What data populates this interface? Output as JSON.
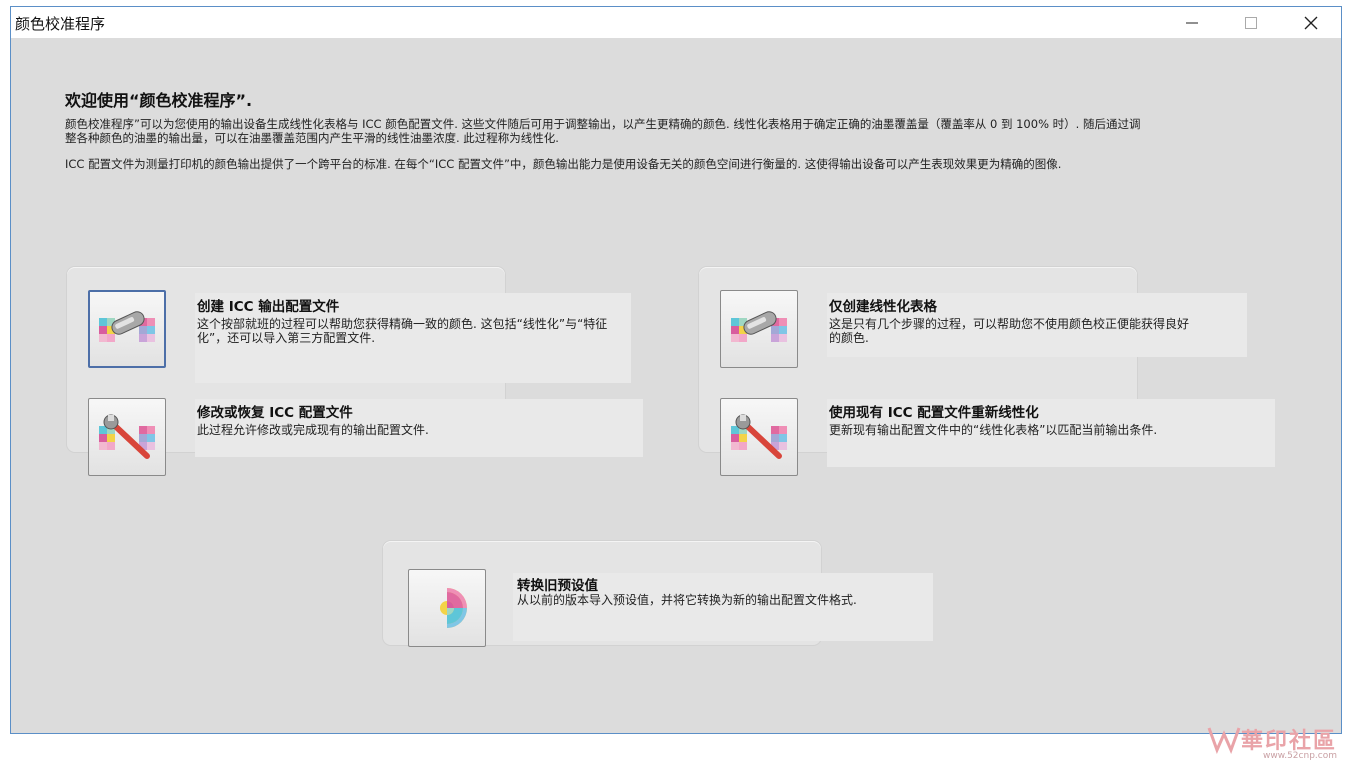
{
  "window": {
    "title": "颜色校准程序"
  },
  "welcome": {
    "title": "欢迎使用“颜色校准程序”.",
    "para1": "颜色校准程序”可以为您使用的输出设备生成线性化表格与 ICC 颜色配置文件. 这些文件随后可用于调整输出，以产生更精确的颜色. 线性化表格用于确定正确的油墨覆盖量（覆盖率从 0 到 100% 时）. 随后通过调整各种颜色的油墨的输出量，可以在油墨覆盖范围内产生平滑的线性油墨浓度. 此过程称为线性化.",
    "para2": "ICC 配置文件为测量打印机的颜色输出提供了一个跨平台的标准. 在每个“ICC 配置文件”中，颜色输出能力是使用设备无关的颜色空间进行衡量的. 这使得输出设备可以产生表现效果更为精确的图像."
  },
  "options": {
    "create_icc": {
      "title": "创建 ICC 输出配置文件",
      "desc": "这个按部就班的过程可以帮助您获得精确一致的颜色. 这包括“线性化”与“特征化”，还可以导入第三方配置文件."
    },
    "modify_icc": {
      "title": "修改或恢复 ICC 配置文件",
      "desc": "此过程允许修改或完成现有的输出配置文件."
    },
    "linearize_only": {
      "title": "仅创建线性化表格",
      "desc": "这是只有几个步骤的过程，可以帮助您不使用颜色校正便能获得良好的颜色."
    },
    "relinearize": {
      "title": "使用现有 ICC 配置文件重新线性化",
      "desc": "更新现有输出配置文件中的“线性化表格”以匹配当前输出条件."
    },
    "convert_presets": {
      "title": "转换旧预设值",
      "desc": "从以前的版本导入预设值，并将它转换为新的输出配置文件格式."
    }
  },
  "watermark": {
    "text": "華印社區",
    "url": "www.52cnp.com"
  },
  "colors": {
    "accent_border": "#4d6fa8",
    "window_border": "#5b8fc7",
    "background": "#dcdcdc"
  }
}
